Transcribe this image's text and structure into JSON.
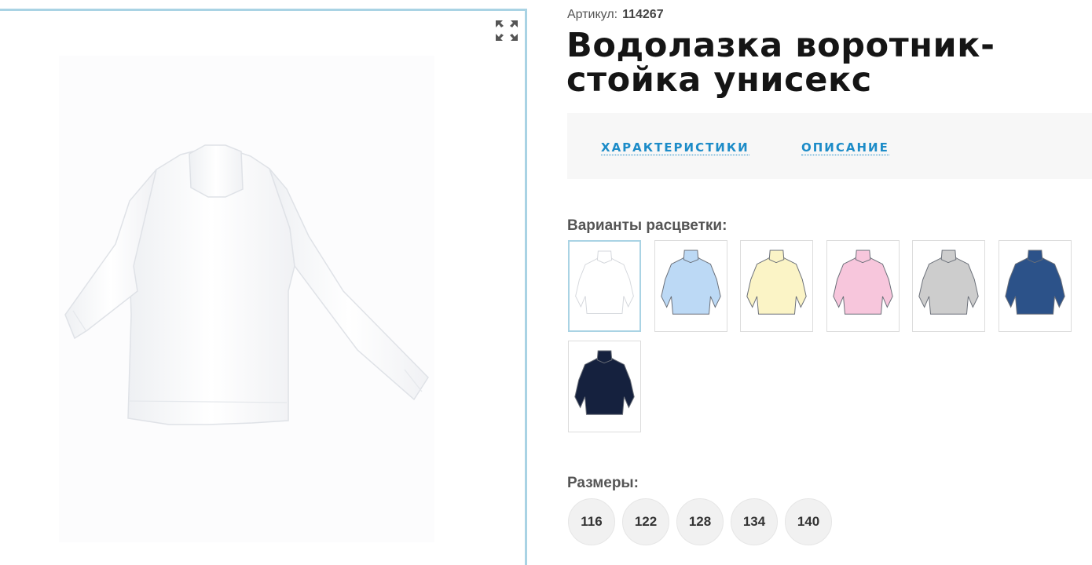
{
  "product": {
    "sku_label": "Артикул:",
    "sku_value": "114267",
    "title": "Водолазка воротник-стойка унисекс"
  },
  "gallery": {
    "expand_icon": "expand-icon",
    "main_photo_color": "#ffffff"
  },
  "tabs": [
    {
      "label": "ХАРАКТЕРИСТИКИ"
    },
    {
      "label": "ОПИСАНИЕ"
    }
  ],
  "colors": {
    "label": "Варианты расцветки:",
    "swatches": [
      {
        "color": "#ffffff",
        "selected": true
      },
      {
        "color": "#bcd9f5",
        "selected": false
      },
      {
        "color": "#fbf4c6",
        "selected": false
      },
      {
        "color": "#f7c6dc",
        "selected": false
      },
      {
        "color": "#cdcdcd",
        "selected": false
      },
      {
        "color": "#2c5289",
        "selected": false
      },
      {
        "color": "#15213e",
        "selected": false
      }
    ]
  },
  "sizes": {
    "label": "Размеры:",
    "options": [
      "116",
      "122",
      "128",
      "134",
      "140"
    ]
  },
  "colors_accent": {
    "link": "#1d8cc8",
    "selected_border": "#a9d3e4"
  }
}
